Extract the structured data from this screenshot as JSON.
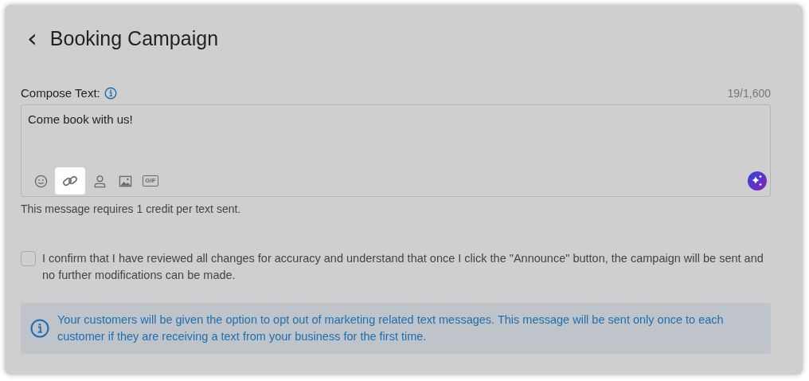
{
  "header": {
    "back_icon": "‹",
    "title": "Booking Campaign"
  },
  "compose": {
    "label": "Compose Text:",
    "counter": "19/1,600",
    "value": "Come book with us!",
    "tools": [
      {
        "kind": "emoji",
        "highlighted": false
      },
      {
        "kind": "link",
        "highlighted": true
      },
      {
        "kind": "person",
        "highlighted": false
      },
      {
        "kind": "image",
        "highlighted": false
      },
      {
        "kind": "gif",
        "label": "GIF",
        "highlighted": false
      }
    ],
    "note": "This message requires 1 credit per text sent."
  },
  "confirm": {
    "checked": false,
    "text": "I confirm that I have reviewed all changes for accuracy and understand that once I click the \"Announce\" button, the campaign will be sent and no further modifications can be made."
  },
  "info": {
    "text": "Your customers will be given the option to opt out of marketing related text messages. This message will be sent only once to each customer if they are receiving a text from your business for the first time."
  }
}
